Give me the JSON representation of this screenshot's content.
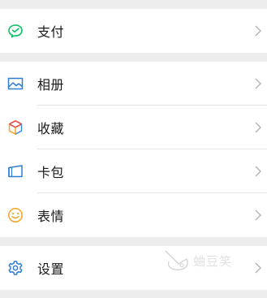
{
  "colors": {
    "background": "#ededed",
    "pay_icon": "#07c160",
    "album_icon": "#2f7dd6",
    "favorites_icon_a": "#f5a623",
    "favorites_icon_b": "#e8453c",
    "favorites_icon_c": "#3b8ee8",
    "cards_icon": "#2f7dd6",
    "emoji_icon": "#f5a623",
    "settings_icon": "#2f7dd6",
    "chevron": "#b2b2b2"
  },
  "menu": {
    "pay": {
      "label": "支付",
      "icon": "pay-icon"
    },
    "album": {
      "label": "相册",
      "icon": "album-icon"
    },
    "favorites": {
      "label": "收藏",
      "icon": "favorites-icon"
    },
    "cards": {
      "label": "卡包",
      "icon": "card-wallet-icon"
    },
    "emoji": {
      "label": "表情",
      "icon": "emoji-icon"
    },
    "settings": {
      "label": "设置",
      "icon": "settings-gear-icon"
    }
  },
  "watermark": {
    "text": "蛐豆笑"
  }
}
